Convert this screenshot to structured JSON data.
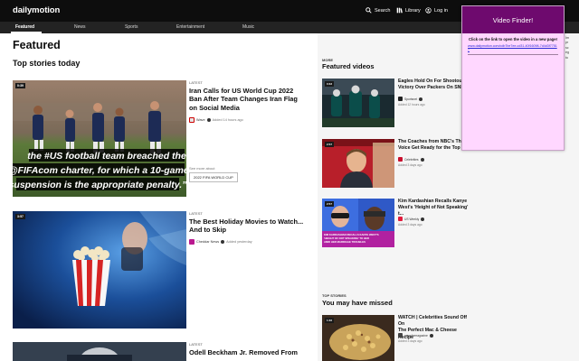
{
  "header": {
    "logo": "dailymotion",
    "search_label": "Search",
    "library_label": "Library",
    "login_label": "Log in"
  },
  "nav": {
    "items": [
      "Featured",
      "News",
      "Sports",
      "Entertainment",
      "Music"
    ]
  },
  "main": {
    "page_title": "Featured",
    "section_title": "Top stories today",
    "stories": [
      {
        "duration": "0:39",
        "category": "LATEST",
        "title_lines": [
          "Iran Calls for US World Cup 2022",
          "Ban After Team Changes Iran Flag",
          "on Social Media"
        ],
        "source": "Wave",
        "time": "Added 14 hours ago",
        "caption_lines": [
          "the #US football team breached the",
          "@FIFAcom charter, for which a 10-game",
          "suspension is the appropriate penalty.”"
        ],
        "see_more": "See more about",
        "tag": "2022 FIFA WORLD CUP"
      },
      {
        "duration": "3:57",
        "category": "LATEST",
        "title_lines": [
          "The Best Holiday Movies to Watch...",
          "And to Skip"
        ],
        "source": "Cheddar News",
        "time": "Added yesterday"
      },
      {
        "duration": "",
        "category": "LATEST",
        "title_lines": [
          "Odell Beckham Jr. Removed From"
        ]
      }
    ]
  },
  "right": {
    "more_label": "MORE",
    "featured_videos_title": "Featured videos",
    "videos": [
      {
        "duration": "0:33",
        "title_lines": [
          "Eagles Hold On For Shootout",
          "Victory Over Packers On SNF"
        ],
        "source": "Sportsnet",
        "time": "Added 12 hours ago"
      },
      {
        "duration": "2:57",
        "title_lines": [
          "The Coaches from NBC's The",
          "Voice Get Ready for the Top 10"
        ],
        "source": "Celebrities",
        "time": "Added 3 days ago"
      },
      {
        "duration": "2:57",
        "title_lines": [
          "Kim Kardashian Recalls Kanye",
          "West's 'Height of Not Speaking' t..."
        ],
        "source": "US Weekly",
        "time": "Added 3 days ago",
        "overlay_lines": [
          "KIM KARDASHIAN RECALLS KANYE WEST'S",
          "'HEIGHT OF NOT SPEAKING' TO HER",
          "AMID HER MARRIAGE TROUBLES"
        ]
      },
      {
        "duration": "1:46",
        "title_lines": [
          "WATCH | Celebrities Sound Off On",
          "The Perfect Mac & Cheese Recipe"
        ],
        "source": "newsformagazine",
        "time": "Added 3 days ago"
      }
    ],
    "top_stories_label": "TOP STORIES",
    "missed_title": "You may have missed"
  },
  "popup": {
    "title": "Video Finder!",
    "instruction": "Click on the link to open the video in a new page!",
    "link": "www.dailymotion.com/cdb7be7ee-cd31-40f16098-7d4d3f77517"
  },
  "cut_text": [
    "Im",
    "pr",
    "sc",
    "eg",
    "to"
  ],
  "colors": {
    "header_bg": "#0d0d0d",
    "nav_bg": "#232323",
    "popup_header": "#6e0a6e",
    "popup_bg": "#ffd7ff",
    "link": "#2b2bd6"
  }
}
